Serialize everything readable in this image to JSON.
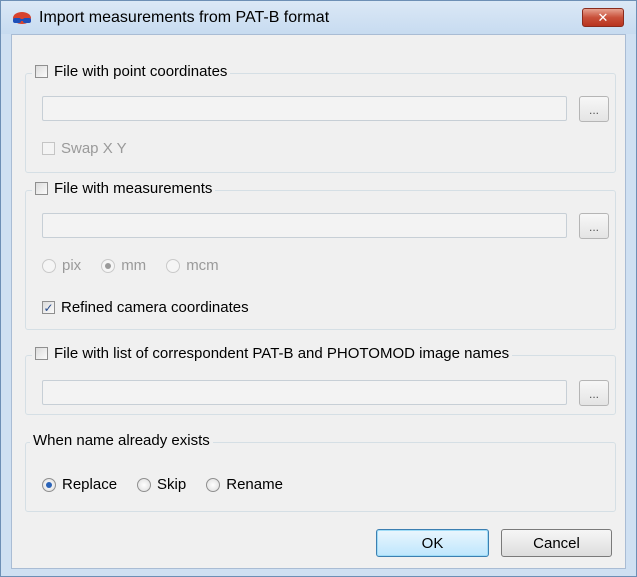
{
  "window": {
    "title": "Import measurements from PAT-B format",
    "close_label": "✕"
  },
  "point_coords": {
    "label": "File with point coordinates",
    "checked": false,
    "path_value": "",
    "browse_label": "...",
    "swap_label": "Swap X Y",
    "swap_checked": false
  },
  "measurements": {
    "label": "File with measurements",
    "checked": false,
    "path_value": "",
    "browse_label": "...",
    "units": [
      {
        "label": "pix",
        "selected": false
      },
      {
        "label": "mm",
        "selected": true
      },
      {
        "label": "mcm",
        "selected": false
      }
    ],
    "refined_label": "Refined camera coordinates",
    "refined_checked": true
  },
  "names_file": {
    "label": "File with list of correspondent PAT-B and PHOTOMOD image names",
    "checked": false,
    "path_value": "",
    "browse_label": "..."
  },
  "existing": {
    "label": "When name already exists",
    "options": [
      {
        "label": "Replace",
        "selected": true
      },
      {
        "label": "Skip",
        "selected": false
      },
      {
        "label": "Rename",
        "selected": false
      }
    ]
  },
  "buttons": {
    "ok": "OK",
    "cancel": "Cancel"
  },
  "icons": {
    "app": "3d-glasses-icon",
    "close": "close-icon",
    "check": "checkmark-icon"
  }
}
